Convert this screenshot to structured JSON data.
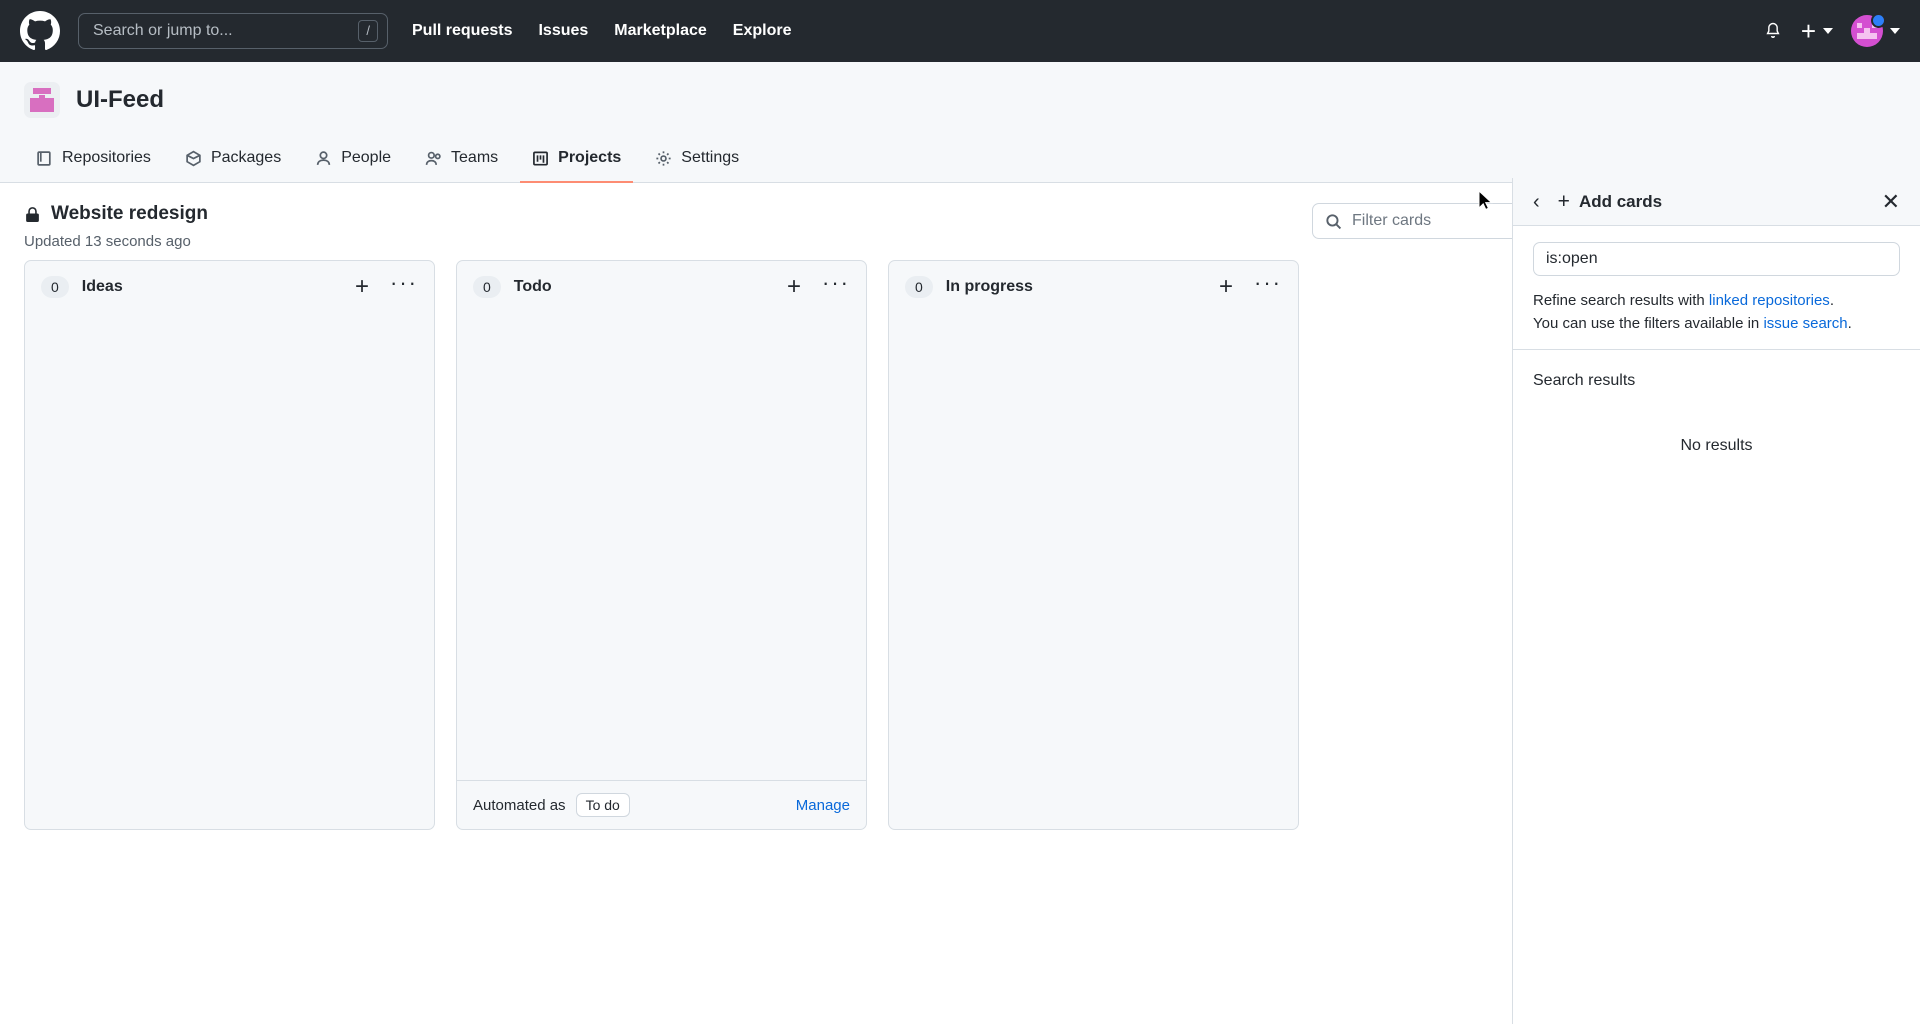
{
  "header": {
    "logo_icon": "github-mark-icon",
    "search": {
      "placeholder": "Search or jump to...",
      "shortcut": "/"
    },
    "nav": [
      {
        "label": "Pull requests"
      },
      {
        "label": "Issues"
      },
      {
        "label": "Marketplace"
      },
      {
        "label": "Explore"
      }
    ],
    "notifications_icon": "bell-icon",
    "create_new_icon": "plus-icon",
    "avatar_icon": "user-avatar",
    "status_dot_color": "#2d7ff9"
  },
  "org": {
    "name": "UI-Feed",
    "avatar_icon": "organization-avatar",
    "tabs": [
      {
        "label": "Repositories",
        "icon": "repo-icon",
        "active": false
      },
      {
        "label": "Packages",
        "icon": "package-icon",
        "active": false
      },
      {
        "label": "People",
        "icon": "person-icon",
        "active": false
      },
      {
        "label": "Teams",
        "icon": "people-icon",
        "active": false
      },
      {
        "label": "Projects",
        "icon": "project-board-icon",
        "active": true
      },
      {
        "label": "Settings",
        "icon": "gear-icon",
        "active": false
      }
    ],
    "active_tab_underline_color": "#fd8c73"
  },
  "project": {
    "title": "Website redesign",
    "visibility_icon": "lock-icon",
    "updated": "Updated 13 seconds ago",
    "filter": {
      "placeholder": "Filter cards",
      "value": "",
      "icon": "search-icon"
    }
  },
  "columns": [
    {
      "name": "Ideas",
      "count": "0",
      "add_icon": "plus-icon",
      "menu_icon": "kebab-horizontal-icon",
      "footer": null
    },
    {
      "name": "Todo",
      "count": "0",
      "add_icon": "plus-icon",
      "menu_icon": "kebab-horizontal-icon",
      "footer": {
        "automated_label": "Automated as",
        "automated_value": "To do",
        "manage_label": "Manage"
      }
    },
    {
      "name": "In progress",
      "count": "0",
      "add_icon": "plus-icon",
      "menu_icon": "kebab-horizontal-icon",
      "footer": null
    }
  ],
  "side_panel": {
    "back_icon": "chevron-left-icon",
    "add_icon": "plus-icon",
    "title": "Add cards",
    "close_icon": "close-icon",
    "search_value": "is:open",
    "search_placeholder": "is:open",
    "hint_line1_prefix": "Refine search results with ",
    "hint_line1_link": "linked repositories",
    "hint_line1_suffix": ".",
    "hint_line2_prefix": "You can use the filters available in ",
    "hint_line2_link": "issue search",
    "hint_line2_suffix": ".",
    "results_title": "Search results",
    "no_results": "No results",
    "link_color": "#0969da"
  }
}
